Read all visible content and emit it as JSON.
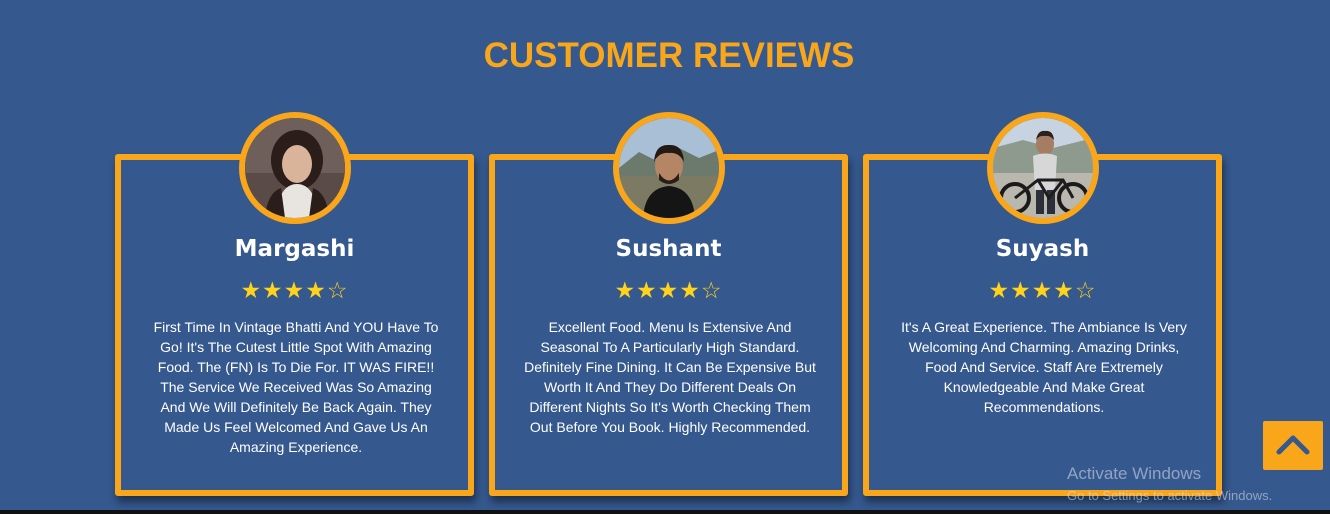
{
  "section": {
    "title": "CUSTOMER REVIEWS"
  },
  "reviews": [
    {
      "name": "Margashi",
      "rating": 4,
      "max_rating": 5,
      "stars_full": "★★★★",
      "stars_empty": "☆",
      "text": "First Time In Vintage Bhatti And YOU Have To Go! It's The Cutest Little Spot With Amazing Food. The (FN) Is To Die For. IT WAS FIRE!! The Service We Received Was So Amazing And We Will Definitely Be Back Again. They Made Us Feel Welcomed And Gave Us An Amazing Experience."
    },
    {
      "name": "Sushant",
      "rating": 4,
      "max_rating": 5,
      "stars_full": "★★★★",
      "stars_empty": "☆",
      "text": "Excellent Food. Menu Is Extensive And Seasonal To A Particularly High Standard. Definitely Fine Dining. It Can Be Expensive But Worth It And They Do Different Deals On Different Nights So It's Worth Checking Them Out Before You Book. Highly Recommended."
    },
    {
      "name": "Suyash",
      "rating": 4,
      "max_rating": 5,
      "stars_full": "★★★★",
      "stars_empty": "☆",
      "text": "It's A Great Experience. The Ambiance Is Very Welcoming And Charming. Amazing Drinks, Food And Service. Staff Are Extremely Knowledgeable And Make Great Recommendations."
    }
  ],
  "scroll_top": {
    "icon": "chevron-up-icon"
  },
  "watermark": {
    "line1": "Activate Windows",
    "line2": "Go to Settings to activate Windows."
  },
  "colors": {
    "background": "#35588e",
    "accent": "#f9a61a",
    "star": "#ffd21c",
    "text": "#ffffff"
  }
}
